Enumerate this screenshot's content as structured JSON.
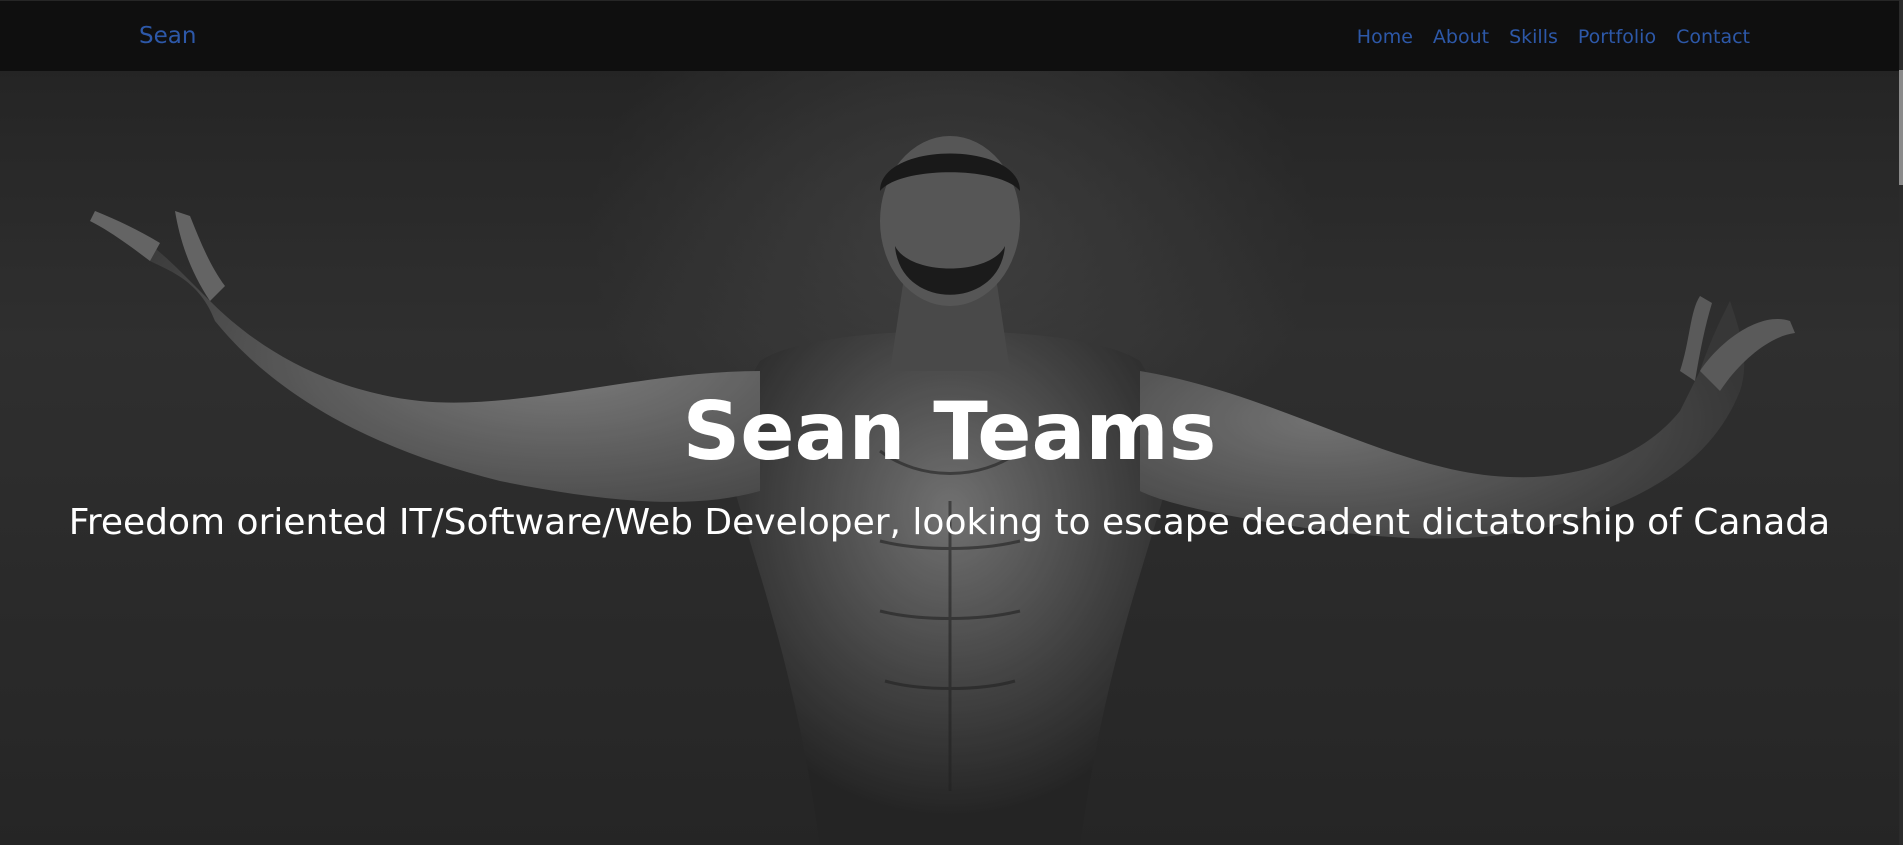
{
  "navbar": {
    "brand": "Sean",
    "links": [
      {
        "label": "Home"
      },
      {
        "label": "About"
      },
      {
        "label": "Skills"
      },
      {
        "label": "Portfolio"
      },
      {
        "label": "Contact"
      }
    ],
    "link_color": "#2d58a8",
    "background": "#0f0f0f"
  },
  "hero": {
    "title": "Sean Teams",
    "subtitle": "Freedom oriented IT/Software/Web Developer, looking to escape decadent dictatorship of Canada",
    "background_image": "monochrome-bodybuilder-photo"
  }
}
